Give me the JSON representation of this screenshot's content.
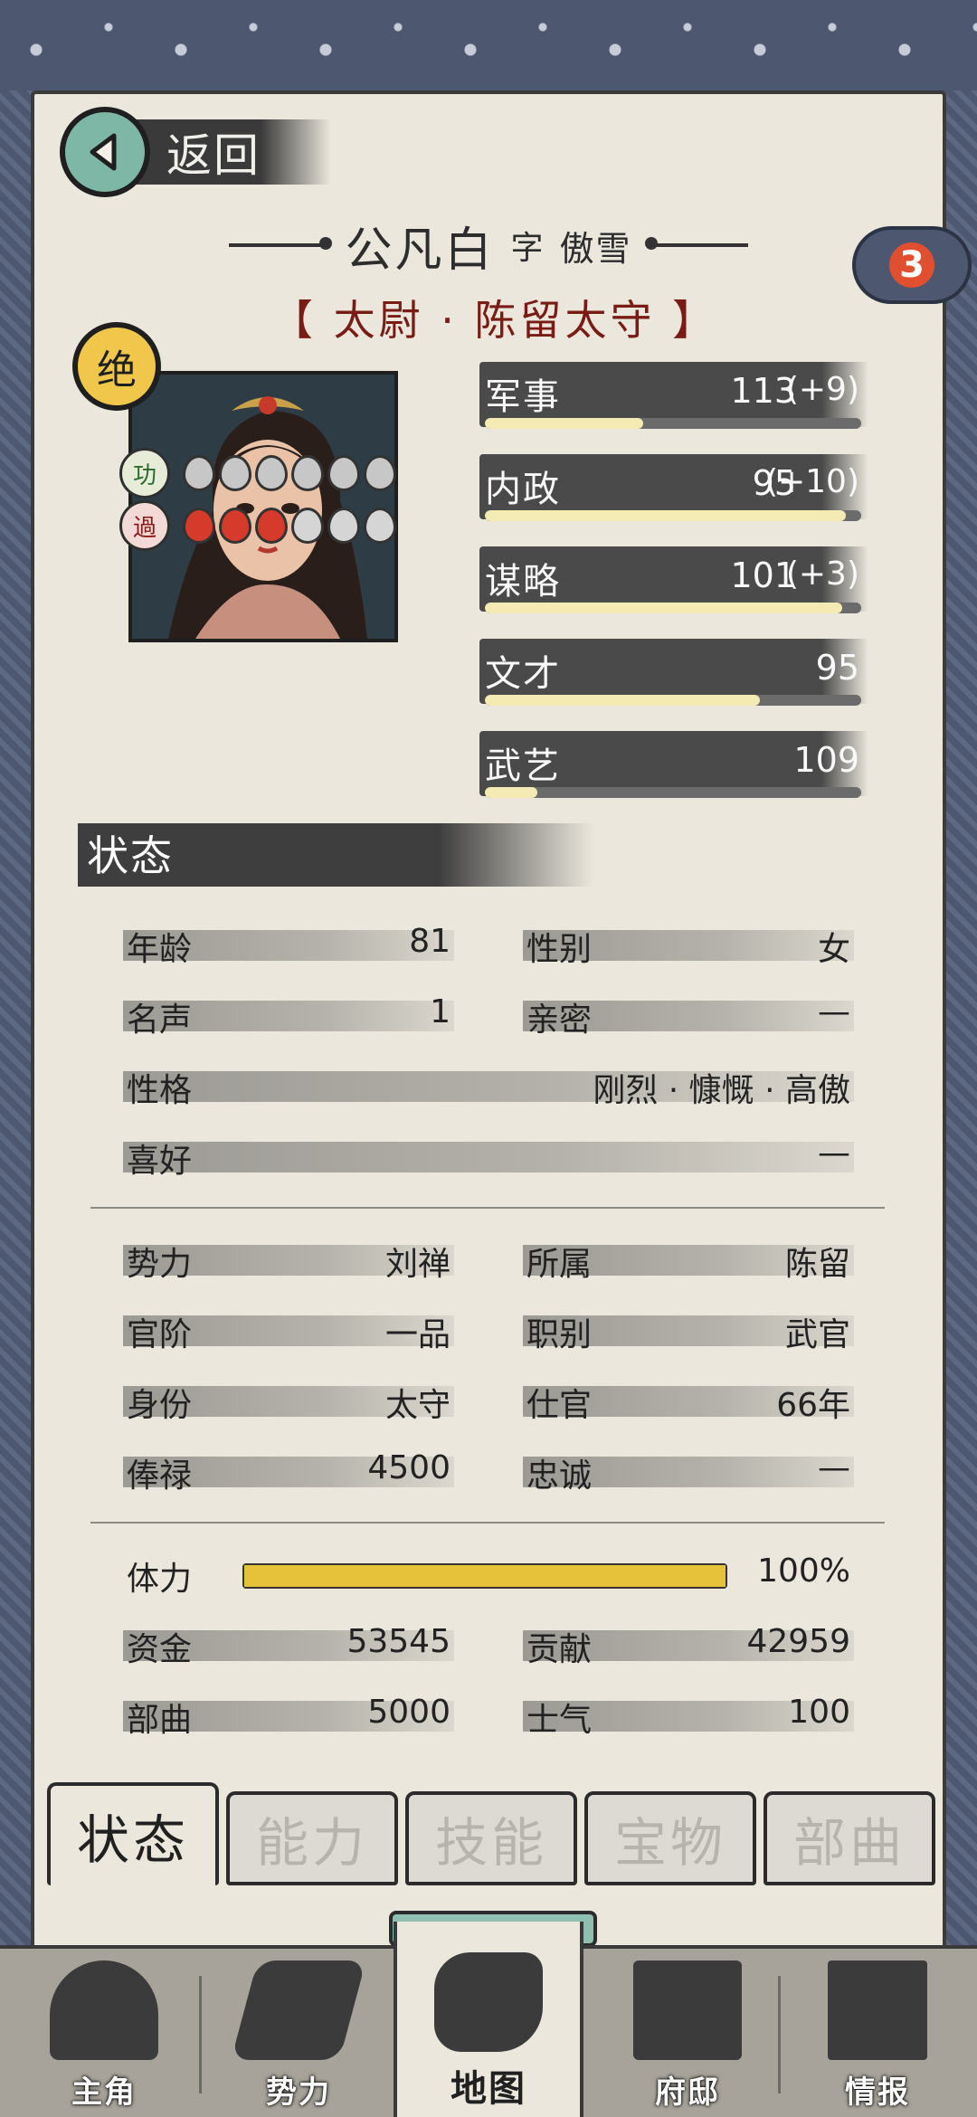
{
  "header": {
    "back_label": "返回",
    "name": "公凡白",
    "zi_label": "字",
    "style_name": "傲雪",
    "title": "【 太尉 · 陈留太守 】",
    "badge_count": "3"
  },
  "portrait": {
    "tier_label": "绝"
  },
  "merit": {
    "label": "功",
    "filled": 6,
    "total": 6
  },
  "demerit": {
    "label": "過",
    "filled": 3,
    "total": 6
  },
  "stats": [
    {
      "label": "军事",
      "value": "113",
      "bonus": "(+9)",
      "fill": 0.42
    },
    {
      "label": "内政",
      "value": "95",
      "bonus": "(+10)",
      "fill": 0.96
    },
    {
      "label": "谋略",
      "value": "101",
      "bonus": "(+3)",
      "fill": 0.95
    },
    {
      "label": "文才",
      "value": "95",
      "bonus": "",
      "fill": 0.73
    },
    {
      "label": "武艺",
      "value": "109",
      "bonus": "",
      "fill": 0.14
    }
  ],
  "status_section": {
    "title": "状态",
    "personal": {
      "age_label": "年龄",
      "age": "81",
      "gender_label": "性别",
      "gender": "女",
      "fame_label": "名声",
      "fame": "1",
      "intimacy_label": "亲密",
      "intimacy": "—",
      "personality_label": "性格",
      "personality": "刚烈 · 慷慨 · 高傲",
      "hobby_label": "喜好",
      "hobby": "—"
    },
    "official": {
      "faction_label": "势力",
      "faction": "刘禅",
      "belong_label": "所属",
      "belong": "陈留",
      "rank_label": "官阶",
      "rank": "一品",
      "post_type_label": "职别",
      "post_type": "武官",
      "identity_label": "身份",
      "identity": "太守",
      "service_label": "仕官",
      "service": "66年",
      "salary_label": "俸禄",
      "salary": "4500",
      "loyalty_label": "忠诚",
      "loyalty": "—"
    },
    "resources": {
      "stamina_label": "体力",
      "stamina": "100%",
      "stamina_fill": 1.0,
      "funds_label": "资金",
      "funds": "53545",
      "contribution_label": "贡献",
      "contribution": "42959",
      "troops_label": "部曲",
      "troops": "5000",
      "morale_label": "士气",
      "morale": "100"
    }
  },
  "tabs": [
    "状态",
    "能力",
    "技能",
    "宝物",
    "部曲"
  ],
  "active_tab": 0,
  "nav": [
    "主角",
    "势力",
    "地图",
    "府邸",
    "情报"
  ],
  "active_nav": 2,
  "colors": {
    "accent_red": "#7a1c16",
    "stamina": "#e6c13a",
    "frame": "#4d5870",
    "paper": "#ebe7dd"
  }
}
